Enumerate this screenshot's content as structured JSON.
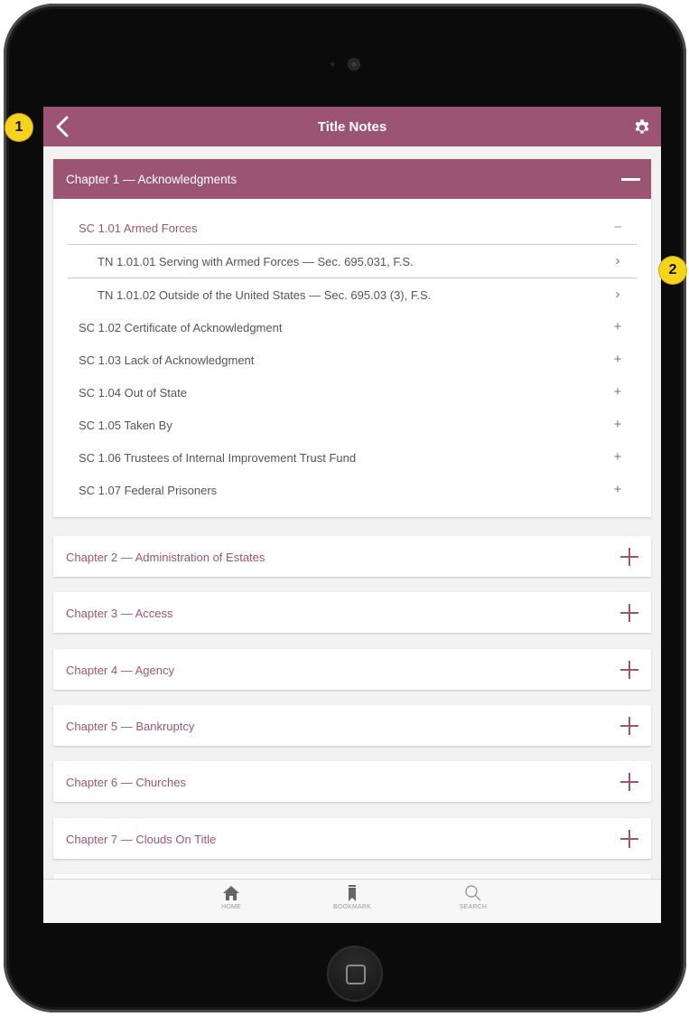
{
  "header": {
    "title": "Title Notes",
    "back_icon": "chevron-left-icon",
    "settings_icon": "gear-icon"
  },
  "accent_color": "#9b5572",
  "open_chapter": {
    "label": "Chapter 1 — Acknowledgments",
    "toggle": "−",
    "subchapters": [
      {
        "label": "SC 1.01 Armed Forces",
        "toggle": "−",
        "expanded": true,
        "notes": [
          {
            "label": "TN 1.01.01 Serving with Armed Forces — Sec. 695.031, F.S.",
            "icon": "›"
          },
          {
            "label": "TN 1.01.02 Outside of the United States — Sec. 695.03 (3), F.S.",
            "icon": "›"
          }
        ]
      },
      {
        "label": "SC 1.02 Certificate of Acknowledgment",
        "toggle": "+"
      },
      {
        "label": "SC 1.03 Lack of Acknowledgment",
        "toggle": "+"
      },
      {
        "label": "SC 1.04 Out of State",
        "toggle": "+"
      },
      {
        "label": "SC 1.05 Taken By",
        "toggle": "+"
      },
      {
        "label": "SC 1.06 Trustees of Internal Improvement Trust Fund",
        "toggle": "+"
      },
      {
        "label": "SC 1.07 Federal Prisoners",
        "toggle": "+"
      }
    ]
  },
  "chapters": [
    {
      "label": "Chapter 2 — Administration of Estates"
    },
    {
      "label": "Chapter 3 — Access"
    },
    {
      "label": "Chapter 4 — Agency"
    },
    {
      "label": "Chapter 5 — Bankruptcy"
    },
    {
      "label": "Chapter 6 — Churches"
    },
    {
      "label": "Chapter 7 — Clouds On Title"
    }
  ],
  "tabs": [
    {
      "label": "HOME",
      "icon": "home-icon"
    },
    {
      "label": "BOOKMARK",
      "icon": "bookmark-icon"
    },
    {
      "label": "SEARCH",
      "icon": "search-icon"
    }
  ],
  "callouts": [
    "1",
    "2"
  ]
}
